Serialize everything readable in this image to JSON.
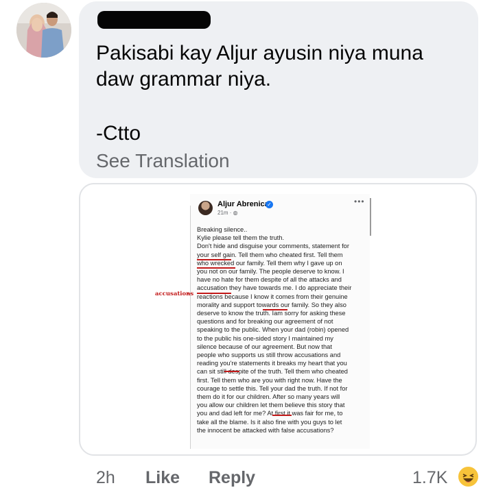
{
  "comment": {
    "author_name": "",
    "lines": [
      "Pakisabi kay Aljur ayusin niya muna",
      "daw grammar niya.",
      "-Ctto"
    ],
    "see_translation": "See Translation"
  },
  "shared_post": {
    "author": "Aljur Abrenica",
    "time": "21m · ",
    "menu_icon": "more-options-icon",
    "annotation": "accusations",
    "body_lines": [
      "Breaking silence..",
      "Kylie please tell them the truth.",
      "Don't hide and disguise your comments, statement for",
      "your self gain. Tell them who cheated first. Tell them",
      "who wrecked our family. Tell them why I gave up on",
      "you not on our family. The people deserve to know. I",
      "have no hate for them despite of all the attacks and",
      "accusation they have towards me. I do appreciate their",
      "reactions because I know it comes from their genuine",
      "morality and support towards our family. So they also",
      "deserve to know the truth. Iam sorry for asking these",
      "questions and for breaking our agreement of not",
      "speaking to the public. When your dad (robin) opened",
      "to the public his one-sided story I maintained my",
      "silence because of our agreement. But now that",
      "people who supports us still throw accusations and",
      "reading you're statements it breaks my heart that you",
      "can sit still despite of the truth. Tell them who cheated",
      "first. Tell them who are you with right now. Have the",
      "courage to settle this. Tell your dad the truth. If not for",
      "them do it for our children. After so many years will",
      "you allow our children let them believe this story that",
      "you and dad left for me? At first it was fair for me, to",
      "take all the blame. Is it also fine with you guys to let",
      "the innocent be attacked with false accusations?"
    ]
  },
  "footer": {
    "time": "2h",
    "like": "Like",
    "reply": "Reply",
    "reaction_count": "1.7K",
    "reaction_icon": "haha-icon"
  },
  "colors": {
    "bubble": "#eef0f3",
    "meta_text": "#65676b",
    "annotation_red": "#c21818",
    "verified_blue": "#1877f2"
  }
}
